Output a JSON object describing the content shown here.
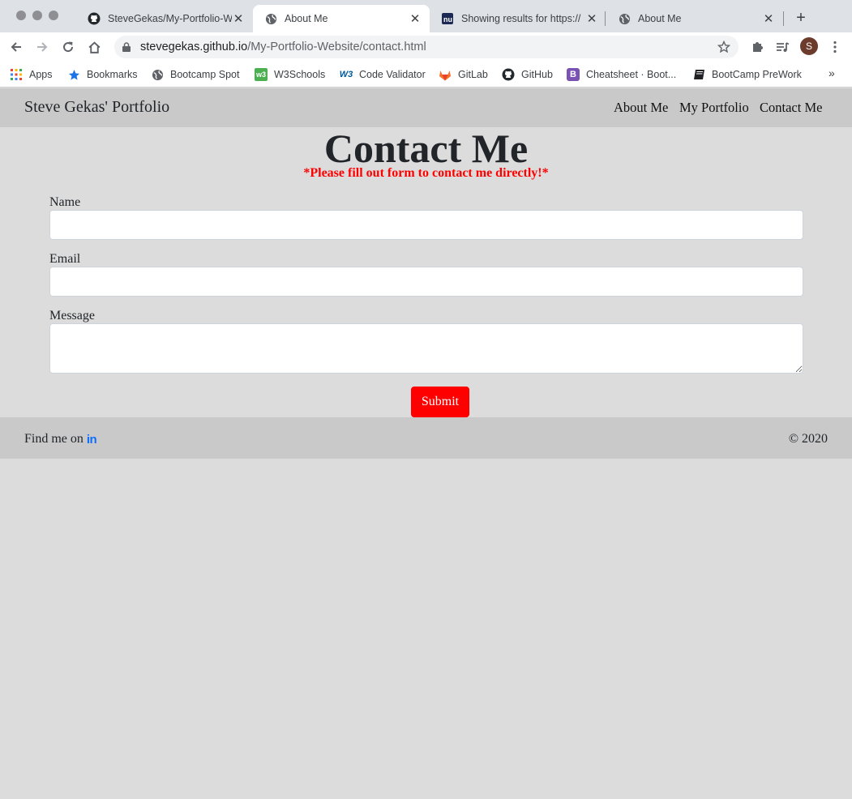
{
  "browser": {
    "tabs": [
      {
        "title": "SteveGekas/My-Portfolio-W",
        "icon": "github-icon",
        "active": false
      },
      {
        "title": "About Me",
        "icon": "globe-icon",
        "active": true
      },
      {
        "title": "Showing results for https://",
        "icon": "validator-icon",
        "active": false
      },
      {
        "title": "About Me",
        "icon": "globe-icon",
        "active": false
      }
    ],
    "url_host": "stevegekas.github.io",
    "url_path": "/My-Portfolio-Website/contact.html",
    "profile_initial": "S",
    "bookmarks": [
      {
        "label": "Apps",
        "icon": "apps-grid-icon"
      },
      {
        "label": "Bookmarks",
        "icon": "star-icon"
      },
      {
        "label": "Bootcamp Spot",
        "icon": "globe-icon"
      },
      {
        "label": "W3Schools",
        "icon": "w3schools-icon"
      },
      {
        "label": "Code Validator",
        "icon": "w3c-icon"
      },
      {
        "label": "GitLab",
        "icon": "gitlab-icon"
      },
      {
        "label": "GitHub",
        "icon": "github-icon"
      },
      {
        "label": "Cheatsheet · Boot...",
        "icon": "bootstrap-icon"
      },
      {
        "label": "BootCamp PreWork",
        "icon": "book-icon"
      }
    ],
    "bookmarks_overflow": "»"
  },
  "site": {
    "brand": "Steve Gekas' Portfolio",
    "nav": [
      "About Me",
      "My Portfolio",
      "Contact Me"
    ],
    "heading": "Contact Me",
    "subheading": "*Please fill out form to contact me directly!*",
    "form": {
      "name_label": "Name",
      "name_value": "",
      "email_label": "Email",
      "email_value": "",
      "message_label": "Message",
      "message_value": "",
      "submit_label": "Submit"
    },
    "footer": {
      "find_me": "Find me on",
      "linkedin_icon": "in",
      "copyright": "© 2020"
    }
  },
  "colors": {
    "accent": "#ff0000",
    "nav_bg": "#c9c9c9",
    "page_bg": "#dcdcdc",
    "linkedin": "#0d6efd"
  }
}
